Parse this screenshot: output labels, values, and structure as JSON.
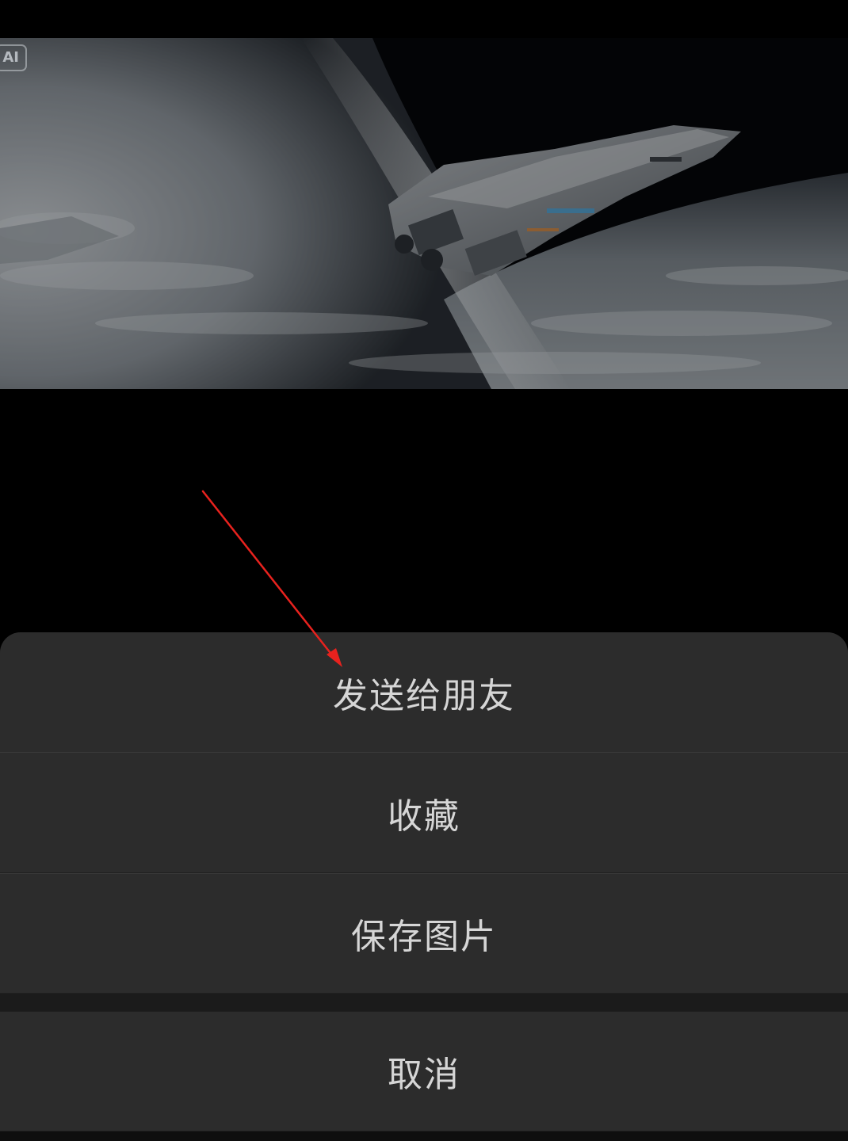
{
  "preview": {
    "badge": "AI"
  },
  "sheet": {
    "send_to_friend": "发送给朋友",
    "favorite": "收藏",
    "save_image": "保存图片",
    "cancel": "取消"
  },
  "colors": {
    "background": "#000000",
    "sheet_item": "#2c2c2c",
    "sheet_text": "#d6d6d6",
    "annotation": "#e8221e"
  },
  "icons": {
    "annotation": "red-arrow-icon"
  }
}
